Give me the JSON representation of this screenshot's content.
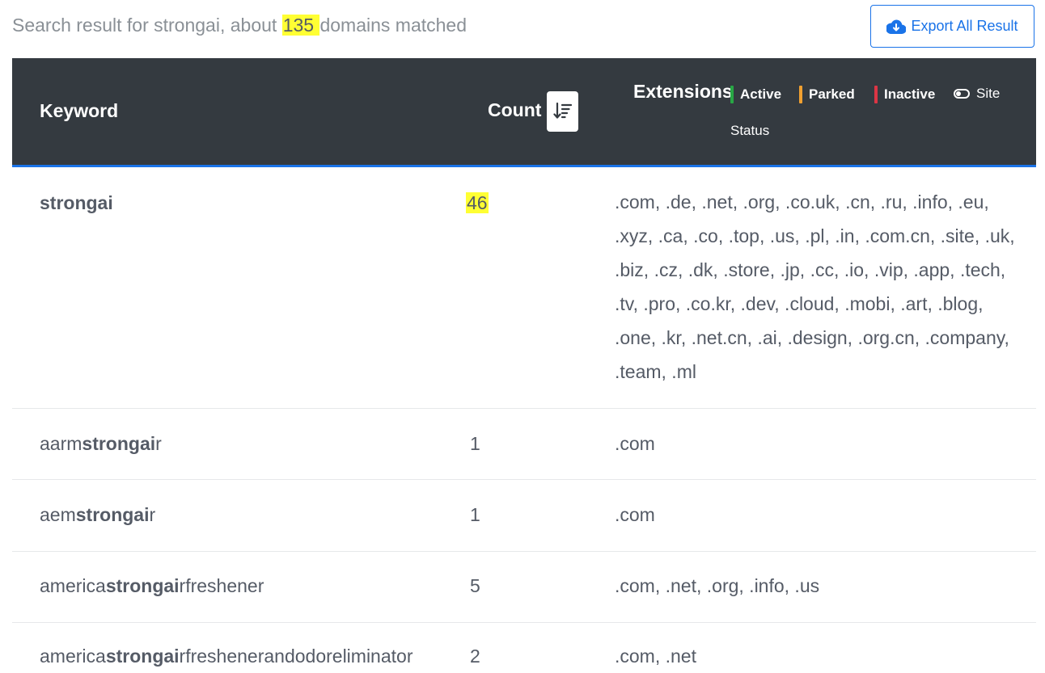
{
  "summary": {
    "prefix": "Search result for strongai, about ",
    "count": "135 ",
    "suffix": "domains matched"
  },
  "export_button": {
    "label": "Export All Result",
    "icon": "cloud-download-icon",
    "color": "#1a73e8"
  },
  "table": {
    "headers": {
      "keyword": "Keyword",
      "count": "Count",
      "extensions": "Extensions"
    },
    "legend": {
      "active": {
        "label": "Active",
        "color": "#28a745"
      },
      "parked": {
        "label": "Parked",
        "color": "#f0a030"
      },
      "inactive": {
        "label": "Inactive",
        "color": "#dc3545"
      },
      "site": "Site",
      "status": "Status"
    },
    "rows": [
      {
        "pre": "",
        "bold": "strongai",
        "post": "",
        "count": "46",
        "extensions": ".com, .de, .net, .org, .co.uk, .cn, .ru, .info, .eu, .xyz, .ca, .co, .top, .us, .pl, .in, .com.cn, .site, .uk, .biz, .cz, .dk, .store, .jp, .cc, .io, .vip, .app, .tech, .tv, .pro, .co.kr, .dev, .cloud, .mobi, .art, .blog, .one, .kr, .net.cn, .ai, .design, .org.cn, .company, .team, .ml"
      },
      {
        "pre": "aarm",
        "bold": "strongai",
        "post": "r",
        "count": "1",
        "extensions": ".com"
      },
      {
        "pre": "aem",
        "bold": "strongai",
        "post": "r",
        "count": "1",
        "extensions": ".com"
      },
      {
        "pre": "america",
        "bold": "strongai",
        "post": "rfreshener",
        "count": "5",
        "extensions": ".com, .net, .org, .info, .us"
      },
      {
        "pre": "america",
        "bold": "strongai",
        "post": "rfreshenerandodoreliminator",
        "count": "2",
        "extensions": ".com, .net"
      }
    ]
  }
}
